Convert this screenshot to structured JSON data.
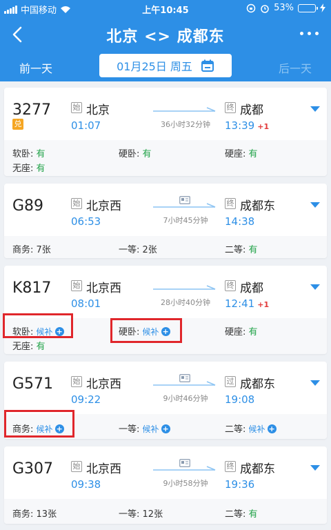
{
  "status_bar": {
    "carrier": "中国移动",
    "time": "上午10:45",
    "battery": "53%",
    "battery_level": 0.53
  },
  "nav": {
    "title": "北京 <> 成都东"
  },
  "date_bar": {
    "prev": "前一天",
    "date": "01月25日 周五",
    "next": "后一天"
  },
  "icons": {
    "accent": "#2d8fe6",
    "available": "#23a34a",
    "highlight": "#e0262b",
    "calendar": "calendar-icon",
    "id_card": "id-card-icon"
  },
  "trains": [
    {
      "number": "3277",
      "badge": "兑",
      "from_tag": "始",
      "from": "北京",
      "depart": "01:07",
      "to_tag": "终",
      "to": "成都",
      "arrive": "13:39",
      "plus": "+1",
      "duration": "36小时32分钟",
      "seats": [
        {
          "label": "软卧:",
          "value": "有"
        },
        {
          "label": "硬卧:",
          "value": "有"
        },
        {
          "label": "硬座:",
          "value": "有"
        },
        {
          "label": "无座:",
          "value": "有"
        }
      ]
    },
    {
      "number": "G89",
      "from_tag": "始",
      "from": "北京西",
      "depart": "06:53",
      "to_tag": "终",
      "to": "成都东",
      "arrive": "14:38",
      "duration": "7小时45分钟",
      "seats": [
        {
          "label": "商务:",
          "value": "7张"
        },
        {
          "label": "一等:",
          "value": "2张"
        },
        {
          "label": "二等:",
          "value": "有"
        }
      ]
    },
    {
      "number": "K817",
      "from_tag": "始",
      "from": "北京西",
      "depart": "08:01",
      "to_tag": "终",
      "to": "成都",
      "arrive": "12:41",
      "plus": "+1",
      "duration": "28小时40分钟",
      "seats": [
        {
          "label": "软卧:",
          "value": "候补"
        },
        {
          "label": "硬卧:",
          "value": "候补"
        },
        {
          "label": "硬座:",
          "value": "有"
        },
        {
          "label": "无座:",
          "value": "有"
        }
      ]
    },
    {
      "number": "G571",
      "from_tag": "始",
      "from": "北京西",
      "depart": "09:22",
      "to_tag": "过",
      "to": "成都东",
      "arrive": "19:08",
      "duration": "9小时46分钟",
      "seats": [
        {
          "label": "商务:",
          "value": "候补"
        },
        {
          "label": "一等:",
          "value": "候补"
        },
        {
          "label": "二等:",
          "value": "候补"
        }
      ]
    },
    {
      "number": "G307",
      "from_tag": "始",
      "from": "北京西",
      "depart": "09:38",
      "to_tag": "终",
      "to": "成都东",
      "arrive": "19:36",
      "duration": "9小时58分钟",
      "seats": [
        {
          "label": "商务:",
          "value": "13张"
        },
        {
          "label": "一等:",
          "value": "12张"
        },
        {
          "label": "二等:",
          "value": "有"
        }
      ]
    }
  ]
}
